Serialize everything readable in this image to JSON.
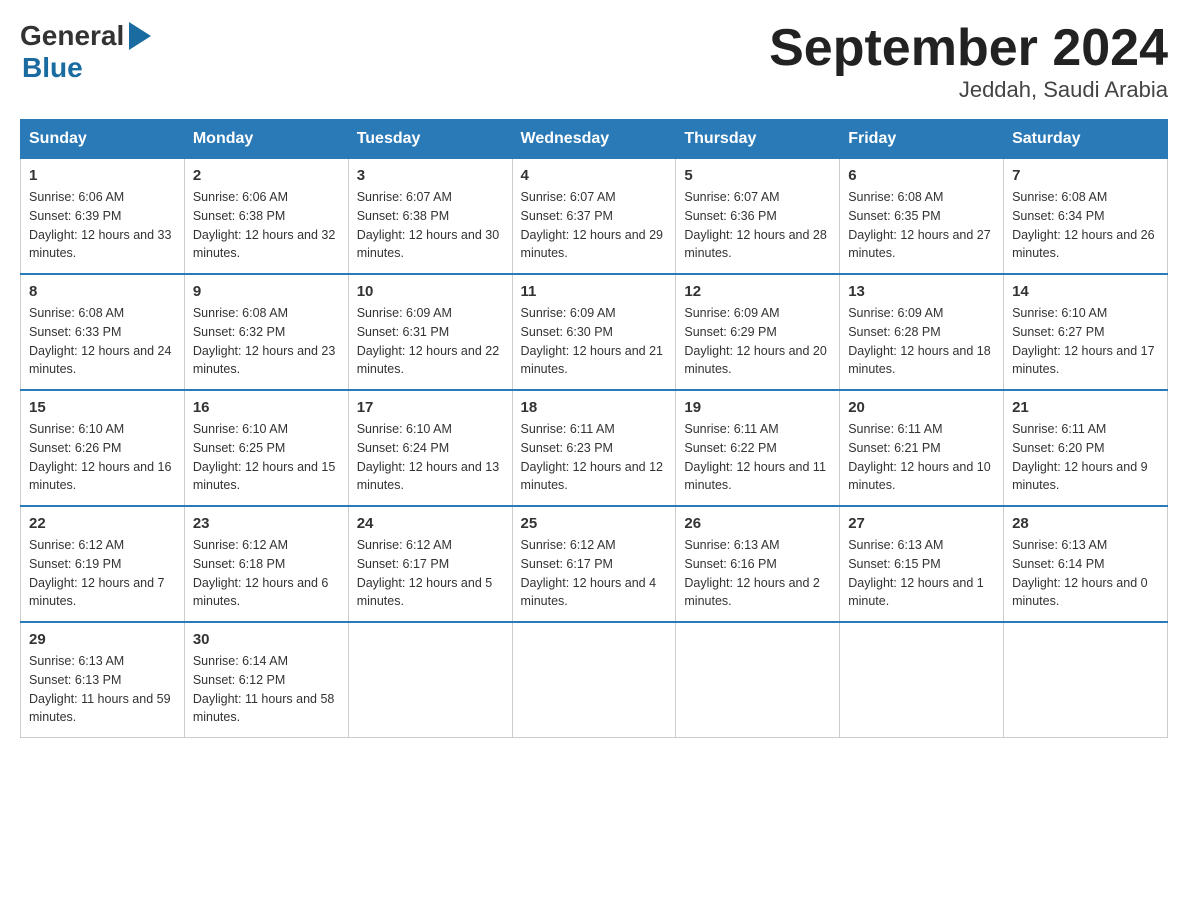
{
  "header": {
    "logo_general": "General",
    "logo_blue": "Blue",
    "title": "September 2024",
    "location": "Jeddah, Saudi Arabia"
  },
  "columns": [
    "Sunday",
    "Monday",
    "Tuesday",
    "Wednesday",
    "Thursday",
    "Friday",
    "Saturday"
  ],
  "weeks": [
    [
      {
        "day": "1",
        "sunrise": "Sunrise: 6:06 AM",
        "sunset": "Sunset: 6:39 PM",
        "daylight": "Daylight: 12 hours and 33 minutes."
      },
      {
        "day": "2",
        "sunrise": "Sunrise: 6:06 AM",
        "sunset": "Sunset: 6:38 PM",
        "daylight": "Daylight: 12 hours and 32 minutes."
      },
      {
        "day": "3",
        "sunrise": "Sunrise: 6:07 AM",
        "sunset": "Sunset: 6:38 PM",
        "daylight": "Daylight: 12 hours and 30 minutes."
      },
      {
        "day": "4",
        "sunrise": "Sunrise: 6:07 AM",
        "sunset": "Sunset: 6:37 PM",
        "daylight": "Daylight: 12 hours and 29 minutes."
      },
      {
        "day": "5",
        "sunrise": "Sunrise: 6:07 AM",
        "sunset": "Sunset: 6:36 PM",
        "daylight": "Daylight: 12 hours and 28 minutes."
      },
      {
        "day": "6",
        "sunrise": "Sunrise: 6:08 AM",
        "sunset": "Sunset: 6:35 PM",
        "daylight": "Daylight: 12 hours and 27 minutes."
      },
      {
        "day": "7",
        "sunrise": "Sunrise: 6:08 AM",
        "sunset": "Sunset: 6:34 PM",
        "daylight": "Daylight: 12 hours and 26 minutes."
      }
    ],
    [
      {
        "day": "8",
        "sunrise": "Sunrise: 6:08 AM",
        "sunset": "Sunset: 6:33 PM",
        "daylight": "Daylight: 12 hours and 24 minutes."
      },
      {
        "day": "9",
        "sunrise": "Sunrise: 6:08 AM",
        "sunset": "Sunset: 6:32 PM",
        "daylight": "Daylight: 12 hours and 23 minutes."
      },
      {
        "day": "10",
        "sunrise": "Sunrise: 6:09 AM",
        "sunset": "Sunset: 6:31 PM",
        "daylight": "Daylight: 12 hours and 22 minutes."
      },
      {
        "day": "11",
        "sunrise": "Sunrise: 6:09 AM",
        "sunset": "Sunset: 6:30 PM",
        "daylight": "Daylight: 12 hours and 21 minutes."
      },
      {
        "day": "12",
        "sunrise": "Sunrise: 6:09 AM",
        "sunset": "Sunset: 6:29 PM",
        "daylight": "Daylight: 12 hours and 20 minutes."
      },
      {
        "day": "13",
        "sunrise": "Sunrise: 6:09 AM",
        "sunset": "Sunset: 6:28 PM",
        "daylight": "Daylight: 12 hours and 18 minutes."
      },
      {
        "day": "14",
        "sunrise": "Sunrise: 6:10 AM",
        "sunset": "Sunset: 6:27 PM",
        "daylight": "Daylight: 12 hours and 17 minutes."
      }
    ],
    [
      {
        "day": "15",
        "sunrise": "Sunrise: 6:10 AM",
        "sunset": "Sunset: 6:26 PM",
        "daylight": "Daylight: 12 hours and 16 minutes."
      },
      {
        "day": "16",
        "sunrise": "Sunrise: 6:10 AM",
        "sunset": "Sunset: 6:25 PM",
        "daylight": "Daylight: 12 hours and 15 minutes."
      },
      {
        "day": "17",
        "sunrise": "Sunrise: 6:10 AM",
        "sunset": "Sunset: 6:24 PM",
        "daylight": "Daylight: 12 hours and 13 minutes."
      },
      {
        "day": "18",
        "sunrise": "Sunrise: 6:11 AM",
        "sunset": "Sunset: 6:23 PM",
        "daylight": "Daylight: 12 hours and 12 minutes."
      },
      {
        "day": "19",
        "sunrise": "Sunrise: 6:11 AM",
        "sunset": "Sunset: 6:22 PM",
        "daylight": "Daylight: 12 hours and 11 minutes."
      },
      {
        "day": "20",
        "sunrise": "Sunrise: 6:11 AM",
        "sunset": "Sunset: 6:21 PM",
        "daylight": "Daylight: 12 hours and 10 minutes."
      },
      {
        "day": "21",
        "sunrise": "Sunrise: 6:11 AM",
        "sunset": "Sunset: 6:20 PM",
        "daylight": "Daylight: 12 hours and 9 minutes."
      }
    ],
    [
      {
        "day": "22",
        "sunrise": "Sunrise: 6:12 AM",
        "sunset": "Sunset: 6:19 PM",
        "daylight": "Daylight: 12 hours and 7 minutes."
      },
      {
        "day": "23",
        "sunrise": "Sunrise: 6:12 AM",
        "sunset": "Sunset: 6:18 PM",
        "daylight": "Daylight: 12 hours and 6 minutes."
      },
      {
        "day": "24",
        "sunrise": "Sunrise: 6:12 AM",
        "sunset": "Sunset: 6:17 PM",
        "daylight": "Daylight: 12 hours and 5 minutes."
      },
      {
        "day": "25",
        "sunrise": "Sunrise: 6:12 AM",
        "sunset": "Sunset: 6:17 PM",
        "daylight": "Daylight: 12 hours and 4 minutes."
      },
      {
        "day": "26",
        "sunrise": "Sunrise: 6:13 AM",
        "sunset": "Sunset: 6:16 PM",
        "daylight": "Daylight: 12 hours and 2 minutes."
      },
      {
        "day": "27",
        "sunrise": "Sunrise: 6:13 AM",
        "sunset": "Sunset: 6:15 PM",
        "daylight": "Daylight: 12 hours and 1 minute."
      },
      {
        "day": "28",
        "sunrise": "Sunrise: 6:13 AM",
        "sunset": "Sunset: 6:14 PM",
        "daylight": "Daylight: 12 hours and 0 minutes."
      }
    ],
    [
      {
        "day": "29",
        "sunrise": "Sunrise: 6:13 AM",
        "sunset": "Sunset: 6:13 PM",
        "daylight": "Daylight: 11 hours and 59 minutes."
      },
      {
        "day": "30",
        "sunrise": "Sunrise: 6:14 AM",
        "sunset": "Sunset: 6:12 PM",
        "daylight": "Daylight: 11 hours and 58 minutes."
      },
      null,
      null,
      null,
      null,
      null
    ]
  ]
}
